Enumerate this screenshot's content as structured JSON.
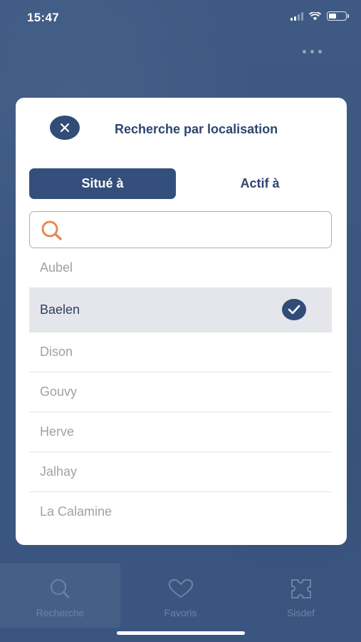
{
  "status_bar": {
    "time": "15:47"
  },
  "modal": {
    "title": "Recherche par localisation",
    "close_icon": "close-icon",
    "segments": [
      {
        "label": "Situé à",
        "active": true
      },
      {
        "label": "Actif à",
        "active": false
      }
    ],
    "search": {
      "value": "",
      "placeholder": "",
      "icon": "search-icon"
    },
    "locations": [
      {
        "name": "Aubel",
        "selected": false
      },
      {
        "name": "Baelen",
        "selected": true
      },
      {
        "name": "Dison",
        "selected": false
      },
      {
        "name": "Gouvy",
        "selected": false
      },
      {
        "name": "Herve",
        "selected": false
      },
      {
        "name": "Jalhay",
        "selected": false
      },
      {
        "name": "La Calamine",
        "selected": false
      }
    ]
  },
  "tabs": [
    {
      "label": "Recherche",
      "icon": "search-icon",
      "active": true
    },
    {
      "label": "Favoris",
      "icon": "heart-icon",
      "active": false
    },
    {
      "label": "Sisdef",
      "icon": "puzzle-icon",
      "active": false
    }
  ],
  "colors": {
    "primary": "#344f7b",
    "background": "#3b5781",
    "accent_search": "#e58a55"
  }
}
